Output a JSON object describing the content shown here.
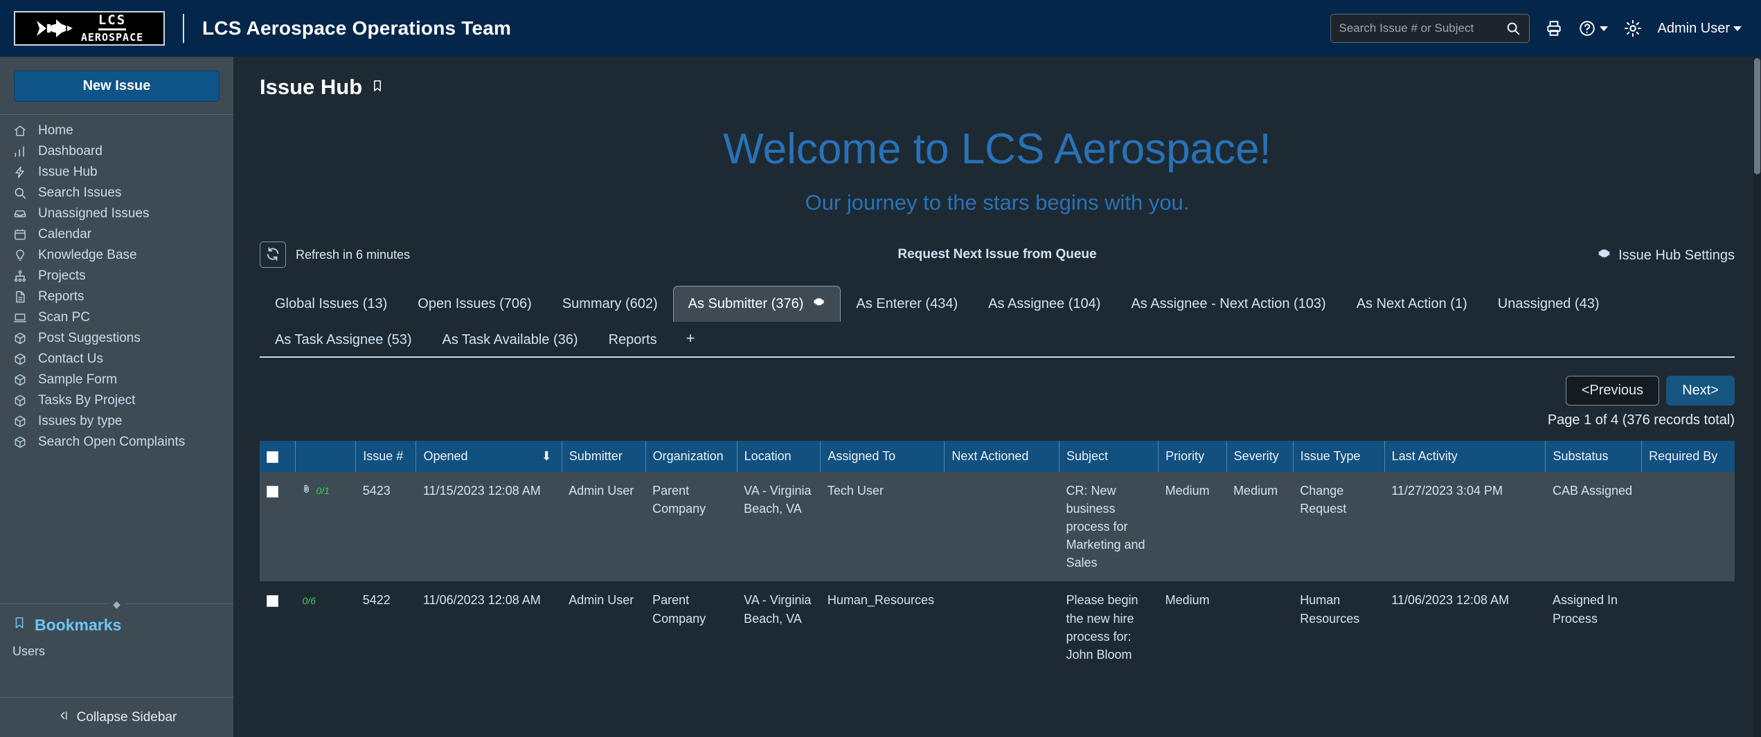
{
  "topbar": {
    "logo_line1": "LCS",
    "logo_line2": "AEROSPACE",
    "app_title": "LCS Aerospace Operations Team",
    "search_placeholder": "Search Issue # or Subject",
    "search_value": "",
    "user_label": "Admin User"
  },
  "sidebar": {
    "new_issue_label": "New Issue",
    "items": [
      {
        "label": "Home",
        "icon": "home-icon"
      },
      {
        "label": "Dashboard",
        "icon": "chart-bar-icon"
      },
      {
        "label": "Issue Hub",
        "icon": "bolt-icon"
      },
      {
        "label": "Search Issues",
        "icon": "search-icon"
      },
      {
        "label": "Unassigned Issues",
        "icon": "inbox-icon"
      },
      {
        "label": "Calendar",
        "icon": "calendar-icon"
      },
      {
        "label": "Knowledge Base",
        "icon": "lightbulb-icon"
      },
      {
        "label": "Projects",
        "icon": "sitemap-icon"
      },
      {
        "label": "Reports",
        "icon": "document-icon"
      },
      {
        "label": "Scan PC",
        "icon": "laptop-icon"
      },
      {
        "label": "Post Suggestions",
        "icon": "cube-icon"
      },
      {
        "label": "Contact Us",
        "icon": "cube-icon"
      },
      {
        "label": "Sample Form",
        "icon": "cube-icon"
      },
      {
        "label": "Tasks By Project",
        "icon": "cube-icon"
      },
      {
        "label": "Issues by type",
        "icon": "cube-icon"
      },
      {
        "label": "Search Open Complaints",
        "icon": "cube-icon"
      }
    ],
    "bookmarks_title": "Bookmarks",
    "bookmarks": [
      "Users"
    ],
    "collapse_label": "Collapse Sidebar"
  },
  "main": {
    "page_title": "Issue Hub",
    "welcome_heading": "Welcome to LCS Aerospace!",
    "welcome_sub": "Our journey to the stars begins with you.",
    "refresh_label": "Refresh in 6 minutes",
    "queue_link": "Request Next Issue from Queue",
    "settings_link": "Issue Hub Settings",
    "tabs": [
      {
        "label": "Global Issues (13)",
        "active": false,
        "gear": false
      },
      {
        "label": "Open Issues (706)",
        "active": false,
        "gear": false
      },
      {
        "label": "Summary (602)",
        "active": false,
        "gear": false
      },
      {
        "label": "As Submitter (376)",
        "active": true,
        "gear": true
      },
      {
        "label": "As Enterer (434)",
        "active": false,
        "gear": false
      },
      {
        "label": "As Assignee (104)",
        "active": false,
        "gear": false
      },
      {
        "label": "As Assignee - Next Action (103)",
        "active": false,
        "gear": false
      },
      {
        "label": "As Next Action (1)",
        "active": false,
        "gear": false
      },
      {
        "label": "Unassigned (43)",
        "active": false,
        "gear": false
      },
      {
        "label": "As Task Assignee (53)",
        "active": false,
        "gear": false
      },
      {
        "label": "As Task Available (36)",
        "active": false,
        "gear": false
      },
      {
        "label": "Reports",
        "active": false,
        "gear": false
      }
    ],
    "tab_add_label": "+",
    "pager": {
      "previous_label": "<Previous",
      "next_label": "Next>",
      "info": "Page 1 of 4 (376 records total)"
    },
    "table": {
      "columns": [
        "",
        "",
        "Issue #",
        "Opened",
        "Submitter",
        "Organization",
        "Location",
        "Assigned To",
        "Next Actioned",
        "Subject",
        "Priority",
        "Severity",
        "Issue Type",
        "Last Activity",
        "Substatus",
        "Required By"
      ],
      "sorted_column": "Opened",
      "sort_direction": "desc",
      "rows": [
        {
          "attachments": "0/1",
          "has_attachment_icon": true,
          "issue_number": "5423",
          "opened": "11/15/2023 12:08 AM",
          "submitter": "Admin User",
          "organization": "Parent Company",
          "location": "VA - Virginia Beach, VA",
          "assigned_to": "Tech User",
          "next_actioned": "",
          "subject": "CR: New business process for Marketing and Sales",
          "priority": "Medium",
          "severity": "Medium",
          "issue_type": "Change Request",
          "last_activity": "11/27/2023 3:04 PM",
          "substatus": "CAB Assigned",
          "required_by": ""
        },
        {
          "attachments": "0/6",
          "has_attachment_icon": false,
          "issue_number": "5422",
          "opened": "11/06/2023 12:08 AM",
          "submitter": "Admin User",
          "organization": "Parent Company",
          "location": "VA - Virginia Beach, VA",
          "assigned_to": "Human_Resources",
          "next_actioned": "",
          "subject": "Please begin the new hire process for: John Bloom",
          "priority": "Medium",
          "severity": "",
          "issue_type": "Human Resources",
          "last_activity": "11/06/2023 12:08 AM",
          "substatus": "Assigned In Process",
          "required_by": ""
        }
      ]
    }
  },
  "colors": {
    "topbar_bg": "#04264b",
    "sidebar_bg": "#3e4b54",
    "main_bg": "#1e2a33",
    "accent_blue": "#2872b8",
    "table_header": "#12507f",
    "primary_button": "#0e5488",
    "link_text": "#cfe3f4",
    "attachment_green": "#3fcf5c"
  }
}
